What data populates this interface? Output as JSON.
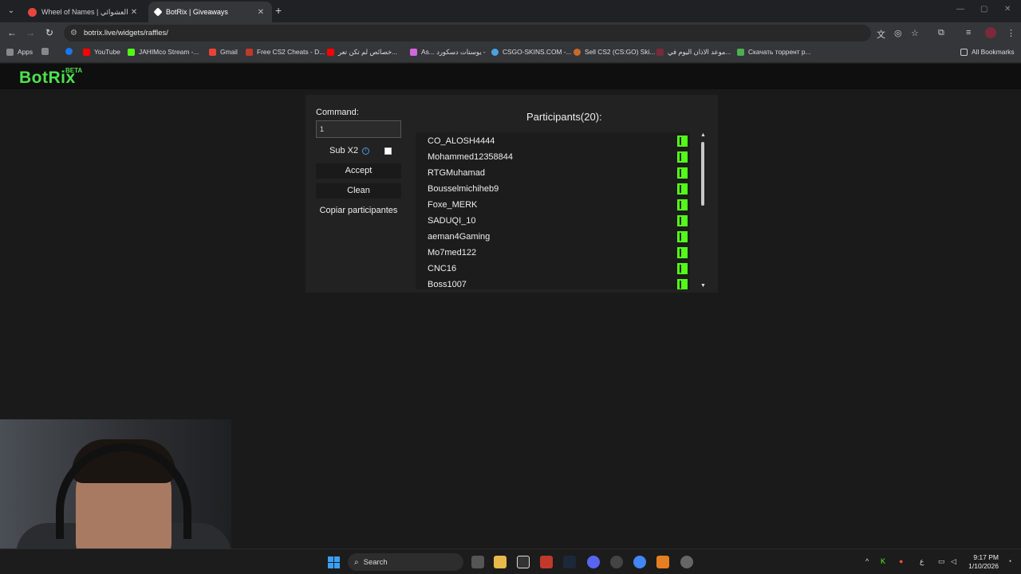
{
  "browser": {
    "tabs": [
      {
        "title": "Wheel of Names | اسم العشوائي",
        "active": false,
        "fav_color": "#e8453c"
      },
      {
        "title": "BotRix | Giveaways",
        "active": true,
        "fav_color": "#ffffff"
      }
    ],
    "url": "botrix.live/widgets/raffles/",
    "bookmarks": [
      {
        "label": "Apps",
        "color": "#888888"
      },
      {
        "label": "",
        "color": "#888888"
      },
      {
        "label": "",
        "color": "#1877f2"
      },
      {
        "label": "YouTube",
        "color": "#ff0000"
      },
      {
        "label": "JAHIMco Stream -...",
        "color": "#53fc18"
      },
      {
        "label": "Gmail",
        "color": "#ea4335"
      },
      {
        "label": "Free CS2 Cheats - D...",
        "color": "#c0392b"
      },
      {
        "label": "خصائص لم تكن تعر...",
        "color": "#ff0000"
      },
      {
        "label": "As... يوستات دسكورد -",
        "color": "#d066e0"
      },
      {
        "label": "CSGO-SKINS.COM -...",
        "color": "#4aa3df"
      },
      {
        "label": "Sell CS2 (CS:GO) Ski...",
        "color": "#c86a2a"
      },
      {
        "label": "موعد الاذان اليوم في...",
        "color": "#7a2a3a"
      },
      {
        "label": "Скачать торрент р...",
        "color": "#4caf50"
      }
    ],
    "all_bookmarks": "All Bookmarks"
  },
  "app": {
    "logo": "BotRix",
    "beta": "BETA",
    "command_label": "Command:",
    "command_value": "1",
    "sub_label": "Sub X2",
    "sub_checked": false,
    "accept_label": "Accept",
    "clean_label": "Clean",
    "copy_label": "Copiar participantes",
    "participants_title": "Participants(20):",
    "participants": [
      "CO_ALOSH4444",
      "Mohammed12358844",
      "RTGMuhamad",
      "Bousselmichiheb9",
      "Foxe_MERK",
      "SADUQI_10",
      "aeman4Gaming",
      "Mo7med122",
      "CNC16",
      "Boss1007"
    ]
  },
  "taskbar": {
    "search_label": "Search",
    "time": "9:17 PM",
    "date": "1/10/2026",
    "lang": "ع"
  }
}
